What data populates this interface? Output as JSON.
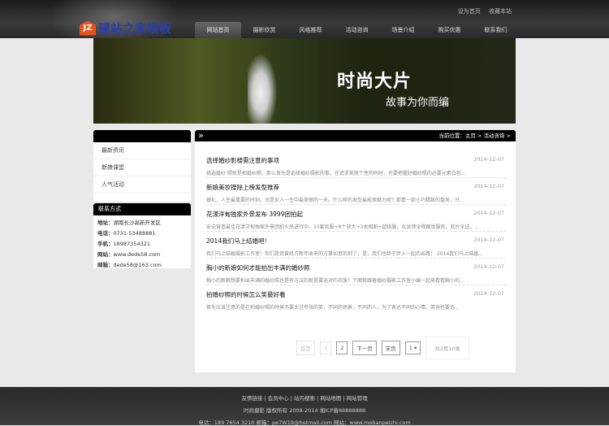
{
  "header": {
    "logo_mark": "JZ",
    "logo_text": "建站之家模板",
    "top_links": [
      "设为首页",
      "收藏本站"
    ],
    "nav": [
      "网站首页",
      "摄影欣赏",
      "风格推荐",
      "活动咨询",
      "场景介绍",
      "购买优惠",
      "联系我们"
    ]
  },
  "banner": {
    "title": "时尚大片",
    "subtitle": "故事为你而编"
  },
  "sidebar": {
    "items": [
      "最新资讯",
      "新娘课堂",
      "人气活动"
    ],
    "contact_title": "联系方式",
    "contact": [
      {
        "label": "地址：",
        "value": "湖南长沙高新开发区"
      },
      {
        "label": "电话：",
        "value": "0731-53488881"
      },
      {
        "label": "手机：",
        "value": "18987354321"
      },
      {
        "label": "网站：",
        "value": "www.dede58.com"
      },
      {
        "label": "邮箱：",
        "value": "dede58@163.com"
      }
    ]
  },
  "main": {
    "breadcrumb": {
      "label": "当前位置：",
      "home": "主页",
      "sep": " > ",
      "current": "活动咨询",
      "tail": " >"
    },
    "articles": [
      {
        "title": "选择婚纱影楼需注意的事项",
        "date": "2014-12-07",
        "desc": "挑选婚纱 照就是拍婚纱照，那么首先是选择婚纱摄影的事。在追求美丽个性的同时，也要把握好婚纱照的必要元素白色..."
      },
      {
        "title": "新娘美妆搜除上榜发型推荐",
        "date": "2014-12-07",
        "desc": "婚礼，人生最重要的时刻，也是女人一生中最美丽的一天。什么样的发型最能显魅力呢？那看一款小巧精致的盘发，只..."
      },
      {
        "title": "花漾洋甸独家外景发布 3999团拍起",
        "date": "2014-12-07",
        "desc": "安全营造最佳花漾洋甸独家外景团拍火热进行中，10套衣服+8个放大+3本相册+超级服，化妆师全程跟妆服务，底片全送。..."
      },
      {
        "title": "2014我们马上结婚吧！",
        "date": "2014-12-07",
        "desc": "我们马上结婚摄影工作室！你们是否曾经方新年收来的万事如意的到了，是，我们也终于步入一起的出路！ 2014我们马上结婚..."
      },
      {
        "title": "胸小的新娘如何才能拍出丰满的婚纱照",
        "date": "2014-12-07",
        "desc": "胸小的新娘想要拍出丰满的婚纱照也是有方法的就是要选对的衣服！下面就跟着婚纱摄影工作室小编一起来看看胸小的..."
      },
      {
        "title": "拍婚纱照的时候怎么笑最好看",
        "date": "2014-12-07",
        "desc": "首先应该注意的是在拍婚纱照的时候不要太过夸张的笑，不同的场景，不同的人，为了表达不同的心情，笑容也要选..."
      }
    ],
    "pagination": {
      "first": "首页",
      "p1": "1",
      "p2": "2",
      "next": "下一页",
      "last": "末页",
      "select": "1 ▾",
      "total": "共2页10条"
    }
  },
  "footer": {
    "links": [
      "友情链接",
      "会员中心",
      "站内搜索",
      "网站地图",
      "网站管理"
    ],
    "sep": " | ",
    "copyright": "时尚摄影 版权所有 2008-2014 湘ICP备88888888",
    "contact": "电话：189 7654 3210 邮箱：pe7W19@hotmail.com 网站：www.mobanpeizhi.com"
  }
}
